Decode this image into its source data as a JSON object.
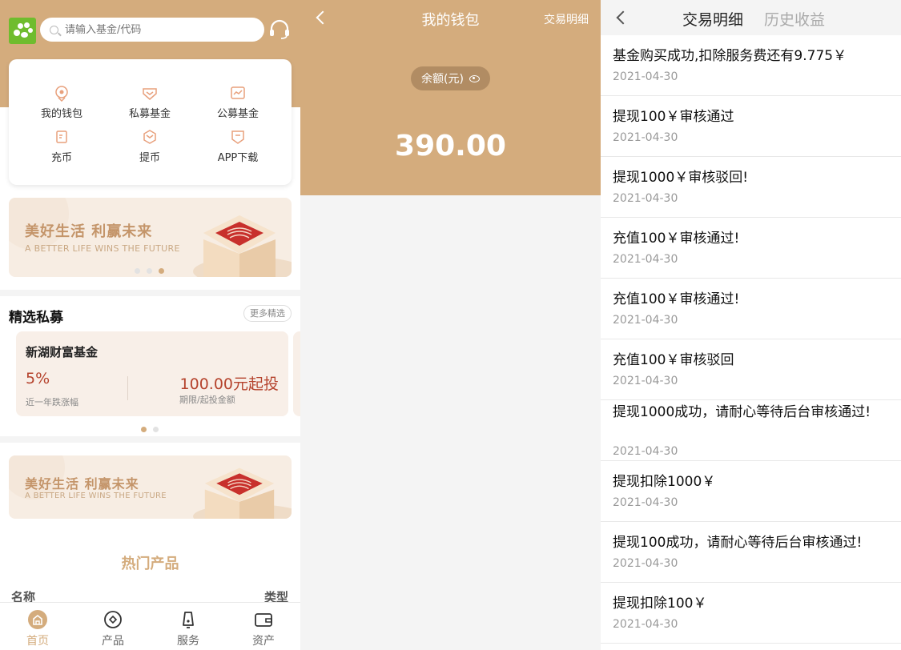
{
  "home": {
    "search_placeholder": "请输入基金/代码",
    "menu": [
      "我的钱包",
      "私募基金",
      "公募基金",
      "充币",
      "提币",
      "APP下载"
    ],
    "banner": {
      "title": "美好生活 利赢未来",
      "subtitle": "A BETTER LIFE WINS THE FUTURE"
    },
    "private_section": {
      "title": "精选私募",
      "more": "更多精选",
      "fund": {
        "name": "新湖财富基金",
        "rate": "5%",
        "rate_label": "近一年跌涨幅",
        "amount": "100.00元起投",
        "amount_label": "期限/起投金额"
      }
    },
    "hot": {
      "title": "热门产品",
      "col_name": "名称",
      "col_type": "类型"
    },
    "tabs": [
      "首页",
      "产品",
      "服务",
      "资产"
    ],
    "colors": {
      "accent": "#d4ac7d",
      "rate_red": "#b5432d"
    }
  },
  "wallet": {
    "title": "我的钱包",
    "link": "交易明细",
    "balance_label": "余额(元)",
    "balance": "390.00"
  },
  "transactions": {
    "tab_active": "交易明细",
    "tab_inactive": "历史收益",
    "records": [
      {
        "text": "基金购买成功,扣除服务费还有9.775￥",
        "date": "2021-04-30"
      },
      {
        "text": "提现100￥审核通过",
        "date": "2021-04-30"
      },
      {
        "text": "提现1000￥审核驳回!",
        "date": "2021-04-30"
      },
      {
        "text": "充值100￥审核通过!",
        "date": "2021-04-30"
      },
      {
        "text": "充值100￥审核通过!",
        "date": "2021-04-30"
      },
      {
        "text": "充值100￥审核驳回",
        "date": "2021-04-30"
      },
      {
        "text": "提现1000成功，请耐心等待后台审核通过!",
        "date": "2021-04-30"
      },
      {
        "text": "提现扣除1000￥",
        "date": "2021-04-30"
      },
      {
        "text": "提现100成功，请耐心等待后台审核通过!",
        "date": "2021-04-30"
      },
      {
        "text": "提现扣除100￥",
        "date": "2021-04-30"
      }
    ]
  }
}
